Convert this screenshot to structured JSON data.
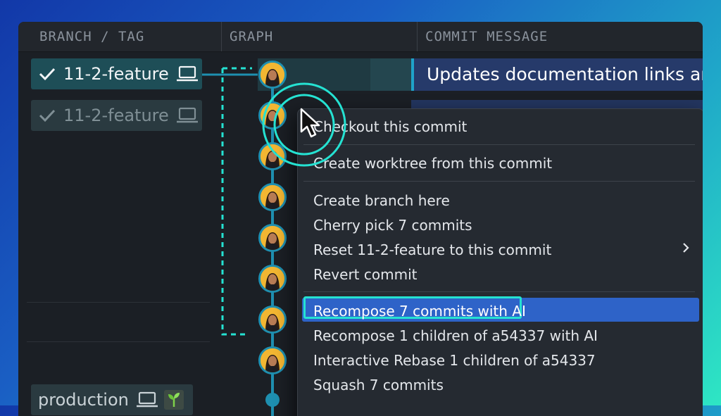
{
  "columns": {
    "branch_tag": "BRANCH / TAG",
    "graph": "GRAPH",
    "commit_message": "COMMIT MESSAGE"
  },
  "branches": [
    {
      "name": "11-2-feature",
      "state": "active"
    },
    {
      "name": "11-2-feature",
      "state": "dimmed"
    },
    {
      "name": "production",
      "state": "remote"
    }
  ],
  "selected_commit_message": "Updates documentation links and",
  "context_menu": {
    "items": [
      "Checkout this commit",
      "Create worktree from this commit",
      "Create branch here",
      "Cherry pick 7 commits",
      "Reset 11-2-feature to this commit",
      "Revert commit",
      "Recompose 7 commits with AI",
      "Recompose 1 children of a54337 with AI",
      "Interactive Rebase 1 children of a54337",
      "Squash 7 commits"
    ],
    "highlighted_item": "Recompose 7 commits with AI",
    "submenu_item": "Reset 11-2-feature to this commit"
  },
  "colors": {
    "accent": "#25e2d2",
    "graph_line": "#1e8fb0",
    "highlight": "#2e63c8"
  },
  "icons": [
    "check-icon",
    "laptop-icon",
    "plant-icon",
    "chevron-right-icon",
    "mouse-pointer-icon"
  ]
}
